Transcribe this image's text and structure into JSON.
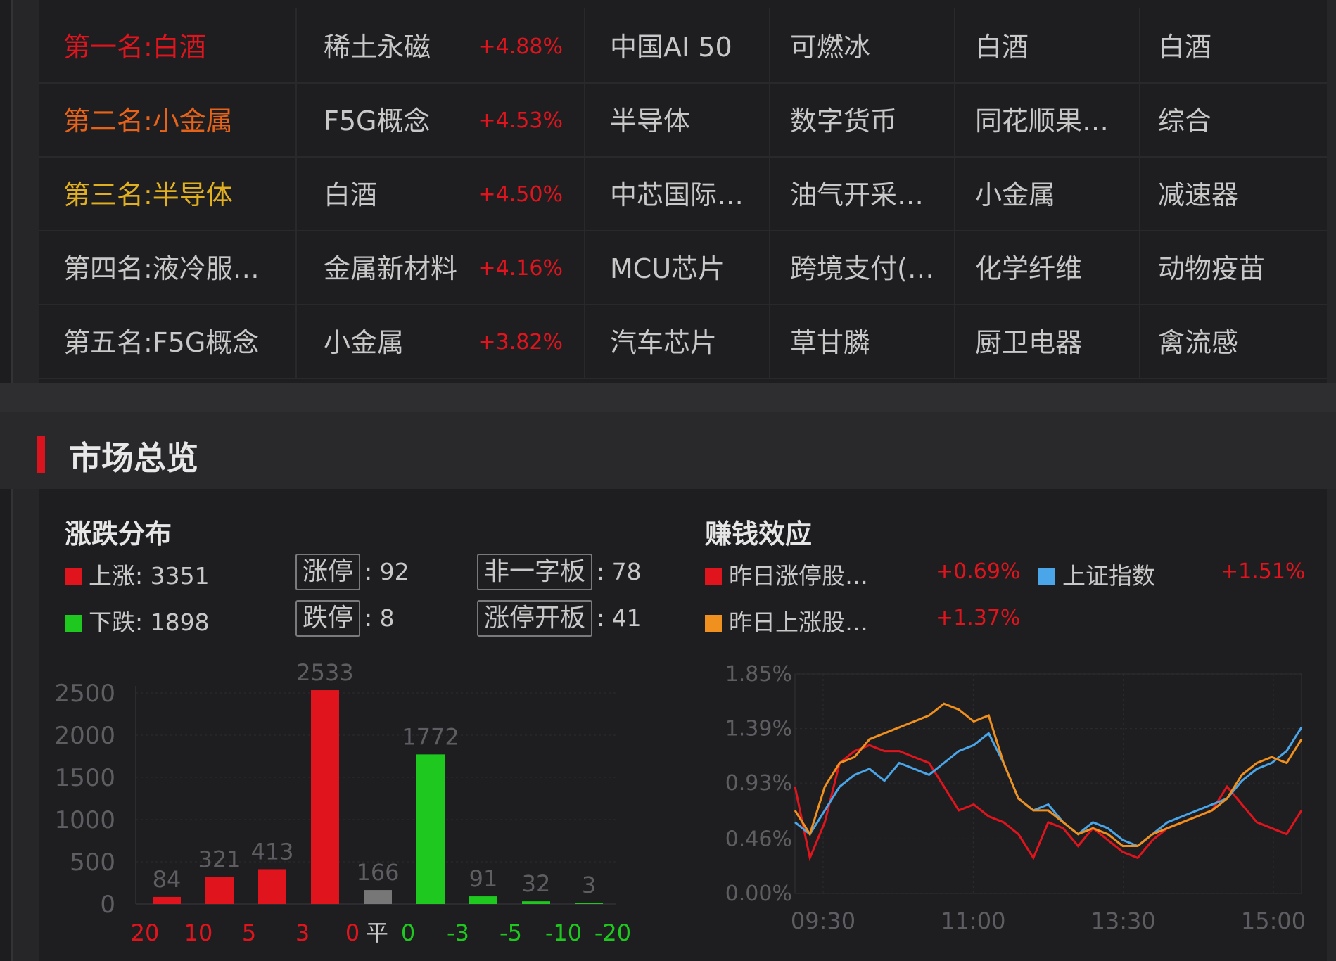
{
  "ranking": {
    "rows": [
      {
        "name": "第一名:白酒",
        "name_color": "#e0141d",
        "c1": "稀土永磁",
        "pct": "+4.88%",
        "c2": "中国AI 50",
        "c3": "可燃冰",
        "c4": "白酒",
        "c5": "白酒"
      },
      {
        "name": "第二名:小金属",
        "name_color": "#e8631a",
        "c1": "F5G概念",
        "pct": "+4.53%",
        "c2": "半导体",
        "c3": "数字货币",
        "c4": "同花顺果…",
        "c5": "综合"
      },
      {
        "name": "第三名:半导体",
        "name_color": "#e0b020",
        "c1": "白酒",
        "pct": "+4.50%",
        "c2": "中芯国际…",
        "c3": "油气开采…",
        "c4": "小金属",
        "c5": "减速器"
      },
      {
        "name": "第四名:液冷服…",
        "name_color": "#c8c8c8",
        "c1": "金属新材料",
        "pct": "+4.16%",
        "c2": "MCU芯片",
        "c3": "跨境支付(…",
        "c4": "化学纤维",
        "c5": "动物疫苗"
      },
      {
        "name": "第五名:F5G概念",
        "name_color": "#c8c8c8",
        "c1": "小金属",
        "pct": "+3.82%",
        "c2": "汽车芯片",
        "c3": "草甘膦",
        "c4": "厨卫电器",
        "c5": "禽流感"
      }
    ]
  },
  "section": {
    "title": "市场总览"
  },
  "distribution": {
    "title": "涨跌分布",
    "up_label": "上涨: 3351",
    "down_label": "下跌: 1898",
    "limit_up_label": "涨停",
    "limit_up_value": ": 92",
    "limit_down_label": "跌停",
    "limit_down_value": ": 8",
    "non_one_label": "非一字板",
    "non_one_value": ": 78",
    "open_label": "涨停开板",
    "open_value": ": 41"
  },
  "profit": {
    "title": "赚钱效应",
    "s1_label": "昨日涨停股…",
    "s1_pct": "+0.69%",
    "s2_label": "上证指数",
    "s2_pct": "+1.51%",
    "s3_label": "昨日上涨股…",
    "s3_pct": "+1.37%"
  },
  "colors": {
    "red": "#e0141d",
    "green": "#1ec81e",
    "gray": "#777777",
    "orange": "#f0901e",
    "blue": "#4aa6e8"
  },
  "chart_data": [
    {
      "type": "bar",
      "categories": [
        "20",
        "10",
        "5",
        "3",
        "0",
        "平",
        "0",
        "-3",
        "-5",
        "-10",
        "-20"
      ],
      "category_colors": [
        "#e0141d",
        "#e0141d",
        "#e0141d",
        "#e0141d",
        "#e0141d",
        "#c8c8c8",
        "#1ec81e",
        "#1ec81e",
        "#1ec81e",
        "#1ec81e",
        "#1ec81e"
      ],
      "bars": [
        {
          "value": 84,
          "label": "84",
          "color": "#e0141d"
        },
        {
          "value": 321,
          "label": "321",
          "color": "#e0141d"
        },
        {
          "value": 413,
          "label": "413",
          "color": "#e0141d"
        },
        {
          "value": 2533,
          "label": "2533",
          "color": "#e0141d"
        },
        {
          "value": 166,
          "label": "166",
          "color": "#777777"
        },
        {
          "value": 1772,
          "label": "1772",
          "color": "#1ec81e"
        },
        {
          "value": 91,
          "label": "91",
          "color": "#1ec81e"
        },
        {
          "value": 32,
          "label": "32",
          "color": "#1ec81e"
        },
        {
          "value": 3,
          "label": "3",
          "color": "#1ec81e"
        }
      ],
      "ylim": [
        0,
        2500
      ],
      "yticks": [
        "2500",
        "2000",
        "1500",
        "1000",
        "500",
        "0"
      ]
    },
    {
      "type": "line",
      "x_ticks": [
        "09:30",
        "11:00",
        "13:30",
        "15:00"
      ],
      "yticks": [
        "1.85%",
        "1.39%",
        "0.93%",
        "0.46%",
        "0.00%"
      ],
      "ylim": [
        0,
        1.85
      ],
      "series": [
        {
          "name": "昨日涨停股…",
          "color": "#e0141d",
          "values": [
            0.9,
            0.3,
            0.6,
            1.1,
            1.2,
            1.25,
            1.2,
            1.2,
            1.15,
            1.1,
            0.9,
            0.7,
            0.75,
            0.65,
            0.6,
            0.5,
            0.3,
            0.6,
            0.55,
            0.4,
            0.55,
            0.45,
            0.35,
            0.3,
            0.45,
            0.55,
            0.6,
            0.65,
            0.7,
            0.9,
            0.75,
            0.6,
            0.55,
            0.5,
            0.7
          ]
        },
        {
          "name": "上证指数",
          "color": "#4aa6e8",
          "values": [
            0.6,
            0.5,
            0.7,
            0.9,
            1.0,
            1.05,
            0.95,
            1.1,
            1.05,
            1.0,
            1.1,
            1.2,
            1.25,
            1.35,
            1.1,
            0.8,
            0.7,
            0.75,
            0.6,
            0.5,
            0.6,
            0.55,
            0.45,
            0.4,
            0.5,
            0.6,
            0.65,
            0.7,
            0.75,
            0.8,
            0.95,
            1.05,
            1.1,
            1.2,
            1.4
          ]
        },
        {
          "name": "昨日上涨股…",
          "color": "#f0901e",
          "values": [
            0.7,
            0.5,
            0.9,
            1.1,
            1.15,
            1.3,
            1.35,
            1.4,
            1.45,
            1.5,
            1.6,
            1.55,
            1.45,
            1.5,
            1.1,
            0.8,
            0.7,
            0.7,
            0.6,
            0.5,
            0.55,
            0.5,
            0.4,
            0.4,
            0.5,
            0.55,
            0.6,
            0.65,
            0.7,
            0.8,
            1.0,
            1.1,
            1.15,
            1.1,
            1.3
          ]
        }
      ]
    }
  ]
}
